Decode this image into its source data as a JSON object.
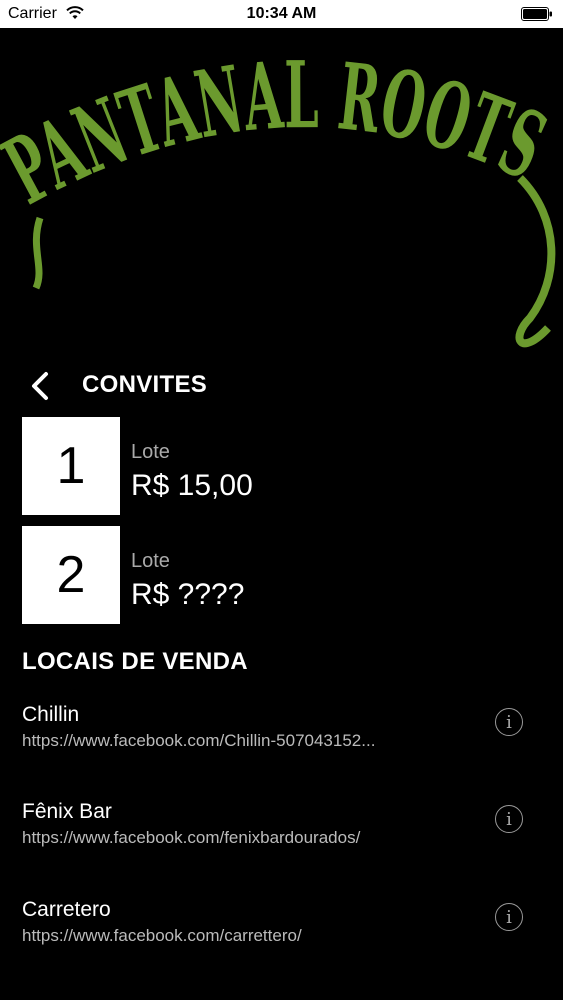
{
  "status": {
    "carrier": "Carrier",
    "time": "10:34 AM"
  },
  "logo": {
    "text": "PANTANAL ROOTS",
    "color": "#6b9a2e"
  },
  "nav": {
    "title": "CONVITES",
    "back_icon": "chevron-left-icon"
  },
  "lots": [
    {
      "number": "1",
      "label": "Lote",
      "price": "R$ 15,00"
    },
    {
      "number": "2",
      "label": "Lote",
      "price": "R$ ????"
    }
  ],
  "sales": {
    "title": "LOCAIS DE VENDA",
    "venues": [
      {
        "name": "Chillin",
        "url": "https://www.facebook.com/Chillin-507043152...",
        "icon": "info-icon"
      },
      {
        "name": "Fênix Bar",
        "url": "https://www.facebook.com/fenixbardourados/",
        "icon": "info-icon"
      },
      {
        "name": "Carretero",
        "url": "https://www.facebook.com/carrettero/",
        "icon": "info-icon"
      }
    ]
  }
}
